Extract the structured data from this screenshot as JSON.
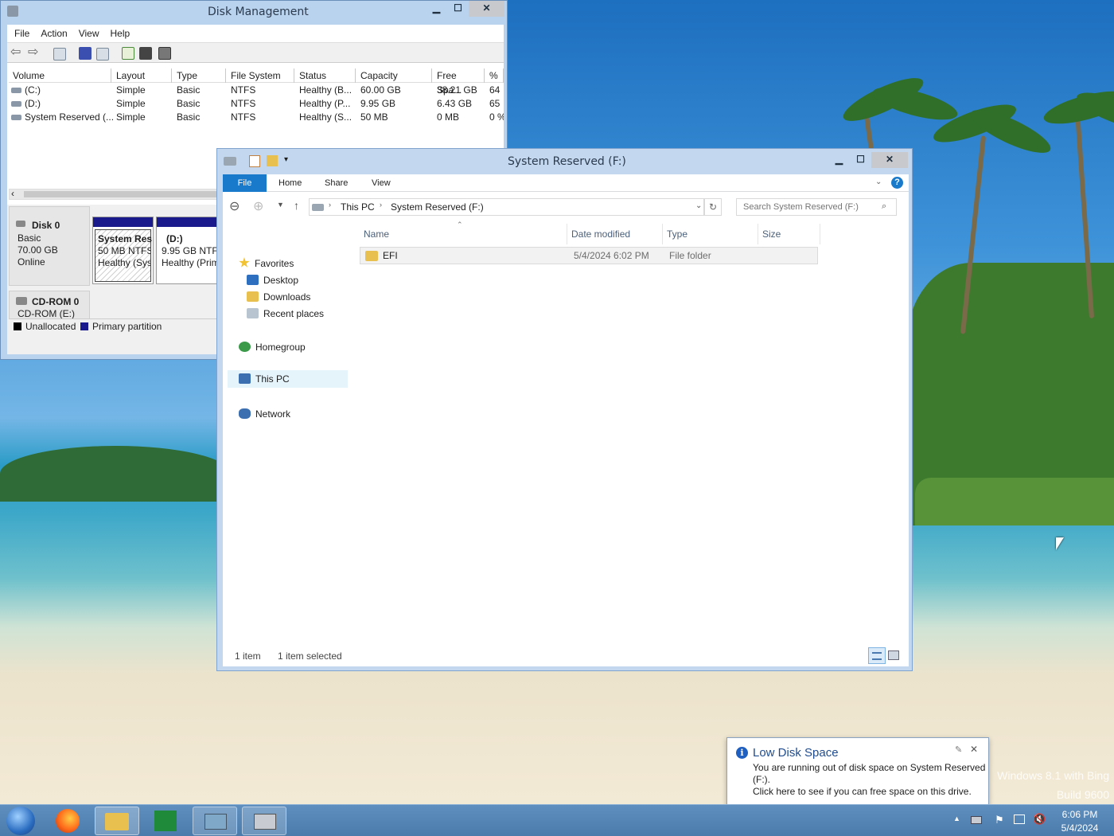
{
  "disk_management": {
    "title": "Disk Management",
    "menu": [
      "File",
      "Action",
      "View",
      "Help"
    ],
    "columns": [
      "Volume",
      "Layout",
      "Type",
      "File System",
      "Status",
      "Capacity",
      "Free Spa...",
      "% F"
    ],
    "rows": [
      [
        "(C:)",
        "Simple",
        "Basic",
        "NTFS",
        "Healthy (B...",
        "60.00 GB",
        "38.21 GB",
        "64"
      ],
      [
        "(D:)",
        "Simple",
        "Basic",
        "NTFS",
        "Healthy (P...",
        "9.95 GB",
        "6.43 GB",
        "65"
      ],
      [
        "System Reserved (...",
        "Simple",
        "Basic",
        "NTFS",
        "Healthy (S...",
        "50 MB",
        "0 MB",
        "0 %"
      ]
    ],
    "disk0": {
      "name": "Disk 0",
      "type": "Basic",
      "size": "70.00 GB",
      "status": "Online"
    },
    "partitions": [
      {
        "name": "System Res",
        "size": "50 MB NTFS",
        "status": "Healthy (Sys"
      },
      {
        "name": "(D:)",
        "size": "9.95 GB NTFS",
        "status": "Healthy (Prim"
      }
    ],
    "cdrom": {
      "name": "CD-ROM 0",
      "drive": "CD-ROM (E:)"
    },
    "legend": [
      "Unallocated",
      "Primary partition"
    ],
    "colors": {
      "primary_partition": "#1a1a8c",
      "unallocated": "#000000"
    }
  },
  "explorer": {
    "title": "System Reserved (F:)",
    "ribbon_tabs": [
      "File",
      "Home",
      "Share",
      "View"
    ],
    "address": [
      "This PC",
      "System Reserved (F:)"
    ],
    "search_placeholder": "Search System Reserved (F:)",
    "nav": {
      "favorites": "Favorites",
      "desktop": "Desktop",
      "downloads": "Downloads",
      "recent": "Recent places",
      "homegroup": "Homegroup",
      "this_pc": "This PC",
      "network": "Network"
    },
    "columns": [
      "Name",
      "Date modified",
      "Type",
      "Size"
    ],
    "files": [
      {
        "name": "EFI",
        "date": "5/4/2024 6:02 PM",
        "type": "File folder",
        "size": ""
      }
    ],
    "status_count": "1 item",
    "status_selected": "1 item selected",
    "accent": "#1979ca"
  },
  "toast": {
    "title": "Low Disk Space",
    "line1": "You are running out of disk space on System Reserved",
    "line2": "(F:).",
    "line3": "Click here to see if you can free space on this drive."
  },
  "watermark": {
    "line1": "Windows 8.1 with Bing",
    "line2": "Build 9600"
  },
  "clock": {
    "time": "6:06 PM",
    "date": "5/4/2024"
  }
}
